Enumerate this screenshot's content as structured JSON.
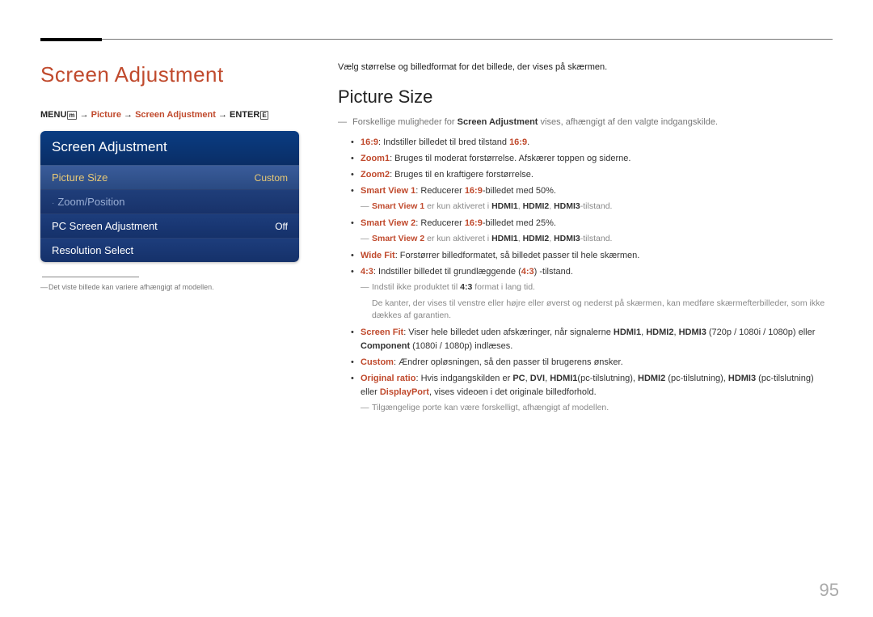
{
  "page_number": "95",
  "left": {
    "heading": "Screen Adjustment",
    "breadcrumb": {
      "menu": "MENU",
      "menu_icon": "m",
      "arrow": " → ",
      "picture": "Picture",
      "screen_adj": "Screen Adjustment",
      "enter": "ENTER",
      "enter_icon": "E"
    },
    "panel": {
      "title": "Screen Adjustment",
      "rows": [
        {
          "label": "Picture Size",
          "value": "Custom",
          "cls": "row-sel"
        },
        {
          "label": "Zoom/Position",
          "value": "",
          "cls": "row-dim",
          "dot": true
        },
        {
          "label": "PC Screen Adjustment",
          "value": "Off",
          "cls": "row-norm"
        },
        {
          "label": "Resolution Select",
          "value": "",
          "cls": "row-norm panel-last"
        }
      ]
    },
    "footnote": "Det viste billede kan variere afhængigt af modellen."
  },
  "right": {
    "intro": "Vælg størrelse og billedformat for det billede, der vises på skærmen.",
    "heading": "Picture Size",
    "note1_pre": "Forskellige muligheder for ",
    "note1_bold": "Screen Adjustment",
    "note1_post": " vises, afhængigt af den valgte indgangskilde.",
    "bullets": {
      "b1_k": "16:9",
      "b1_t": ": Indstiller billedet til bred tilstand ",
      "b1_k2": "16:9",
      "b1_end": ".",
      "b2_k": "Zoom1",
      "b2_t": ": Bruges til moderat forstørrelse. Afskærer toppen og siderne.",
      "b3_k": "Zoom2",
      "b3_t": ": Bruges til en kraftigere forstørrelse.",
      "b4_k": "Smart View 1",
      "b4_t": ": Reducerer ",
      "b4_k2": "16:9",
      "b4_t2": "-billedet med 50%.",
      "b4_sub_k": "Smart View 1",
      "b4_sub_t": " er kun aktiveret i ",
      "b4_sub_h1": "HDMI1",
      "b4_sub_h2": "HDMI2",
      "b4_sub_h3": "HDMI3",
      "b4_sub_end": "-tilstand.",
      "b5_k": "Smart View 2",
      "b5_t": ": Reducerer ",
      "b5_k2": "16:9",
      "b5_t2": "-billedet med 25%.",
      "b5_sub_k": "Smart View 2",
      "b5_sub_t": " er kun aktiveret i ",
      "b5_sub_h1": "HDMI1",
      "b5_sub_h2": "HDMI2",
      "b5_sub_h3": "HDMI3",
      "b5_sub_end": "-tilstand.",
      "b6_k": "Wide Fit",
      "b6_t": ": Forstørrer billedformatet, så billedet passer til hele skærmen.",
      "b7_k": "4:3",
      "b7_t": ": Indstiller billedet til grundlæggende (",
      "b7_k2": "4:3",
      "b7_t2": ") -tilstand.",
      "b7_sub1_pre": "Indstil ikke produktet til ",
      "b7_sub1_k": "4:3",
      "b7_sub1_post": " format i lang tid.",
      "b7_sub2": "De kanter, der vises til venstre eller højre eller øverst og nederst på skærmen, kan medføre skærmefterbilleder, som ikke dækkes af garantien.",
      "b8_k": "Screen Fit",
      "b8_t": ": Viser hele billedet uden afskæringer, når signalerne ",
      "b8_h1": "HDMI1",
      "b8_h2": "HDMI2",
      "b8_h3": "HDMI3",
      "b8_mid": " (720p / 1080i / 1080p) eller ",
      "b8_comp": "Component",
      "b8_end": " (1080i / 1080p) indlæses.",
      "b9_k": "Custom",
      "b9_t": ": Ændrer opløsningen, så den passer til brugerens ønsker.",
      "b10_k": "Original ratio",
      "b10_t": ": Hvis indgangskilden er ",
      "b10_pc": "PC",
      "b10_dvi": "DVI",
      "b10_h1": "HDMI1",
      "b10_h1p": "(pc-tilslutning), ",
      "b10_h2": "HDMI2",
      "b10_h2p": " (pc-tilslutning), ",
      "b10_h3": "HDMI3",
      "b10_h3p": " (pc-tilslutning) eller ",
      "b10_dp": "DisplayPort",
      "b10_end": ", vises videoen i det originale billedforhold.",
      "b10_sub": "Tilgængelige porte kan være forskelligt, afhængigt af modellen."
    }
  }
}
